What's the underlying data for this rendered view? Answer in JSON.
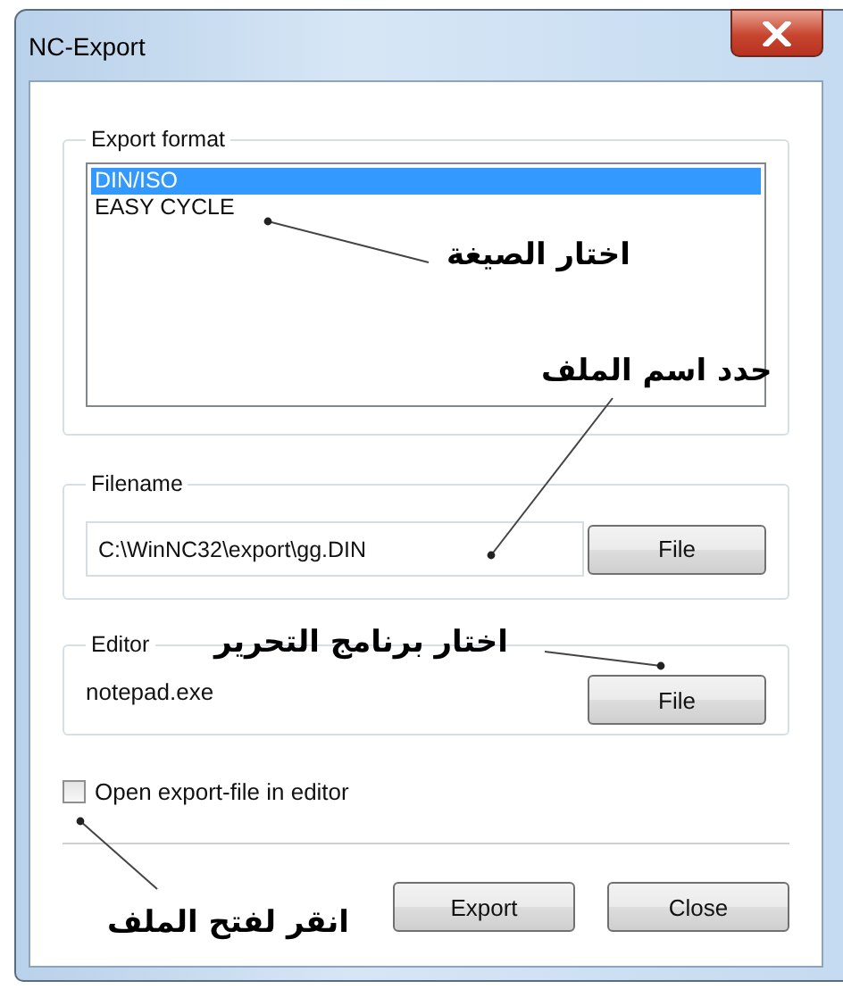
{
  "window": {
    "title": "NC-Export"
  },
  "export_format": {
    "label": "Export format",
    "items": [
      {
        "label": "DIN/ISO",
        "selected": true
      },
      {
        "label": "EASY CYCLE",
        "selected": false
      }
    ]
  },
  "filename": {
    "label": "Filename",
    "value": "C:\\WinNC32\\export\\gg.DIN",
    "button": "File"
  },
  "editor": {
    "label": "Editor",
    "value": "notepad.exe",
    "button": "File"
  },
  "open_in_editor": {
    "label": "Open export-file in editor",
    "checked": false
  },
  "buttons": [
    "Export",
    "Close"
  ],
  "annotations": [
    {
      "text": "اختار الصيغة"
    },
    {
      "text": "حدد اسم الملف"
    },
    {
      "text": "اختار برنامج التحرير"
    },
    {
      "text": "انقر لفتح الملف"
    }
  ]
}
